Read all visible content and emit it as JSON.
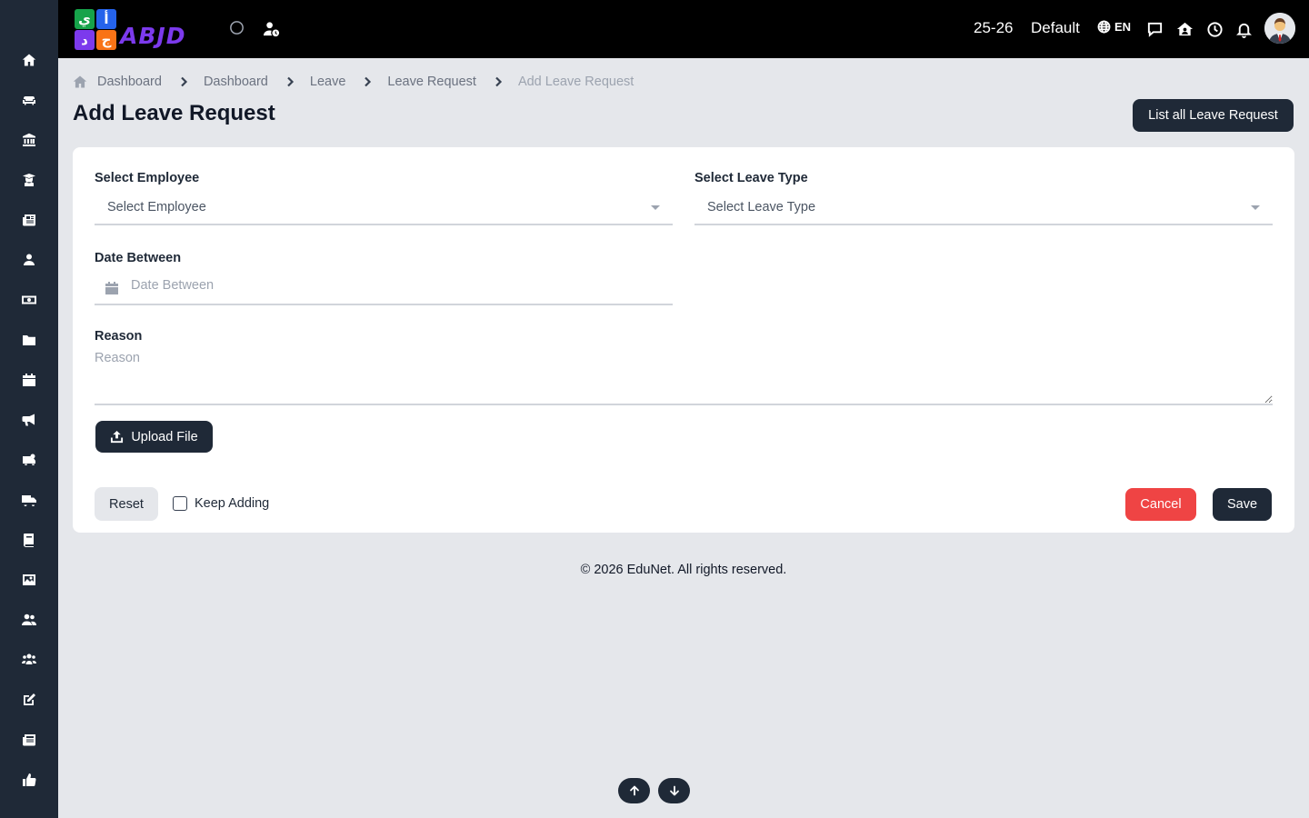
{
  "topbar": {
    "logo": {
      "tiles": [
        "ي",
        "أ",
        "د",
        "ج"
      ],
      "text": "ABJD",
      "tile_colors": [
        "#16a34a",
        "#2563eb",
        "#7c3aed",
        "#f97316"
      ]
    },
    "session": "25-26",
    "school": "Default",
    "language": "EN"
  },
  "breadcrumb": {
    "items": [
      "Dashboard",
      "Dashboard",
      "Leave",
      "Leave Request",
      "Add Leave Request"
    ]
  },
  "page": {
    "title": "Add Leave Request",
    "list_button": "List all Leave Request"
  },
  "form": {
    "employee_label": "Select Employee",
    "employee_placeholder": "Select Employee",
    "leave_type_label": "Select Leave Type",
    "leave_type_placeholder": "Select Leave Type",
    "date_label": "Date Between",
    "date_placeholder": "Date Between",
    "reason_label": "Reason",
    "reason_placeholder": "Reason",
    "upload_label": "Upload File",
    "reset_label": "Reset",
    "keep_adding_label": "Keep Adding",
    "cancel_label": "Cancel",
    "save_label": "Save"
  },
  "footer": {
    "text": "© 2026 EduNet. All rights reserved."
  },
  "colors": {
    "sidebar": "#1f2937",
    "topbar": "#000000",
    "primary": "#1f2937",
    "danger": "#ef4444",
    "background": "#e5e7eb"
  },
  "sidebar_icons": [
    "home-icon",
    "sofa-icon",
    "bank-icon",
    "graduate-icon",
    "newspaper-icon",
    "user-icon",
    "money-icon",
    "folder-icon",
    "calendar-icon",
    "megaphone-icon",
    "school-bus-icon",
    "truck-icon",
    "book-icon",
    "image-icon",
    "users-icon",
    "group-icon",
    "edit-icon",
    "news-icon",
    "thumbs-up-icon"
  ]
}
